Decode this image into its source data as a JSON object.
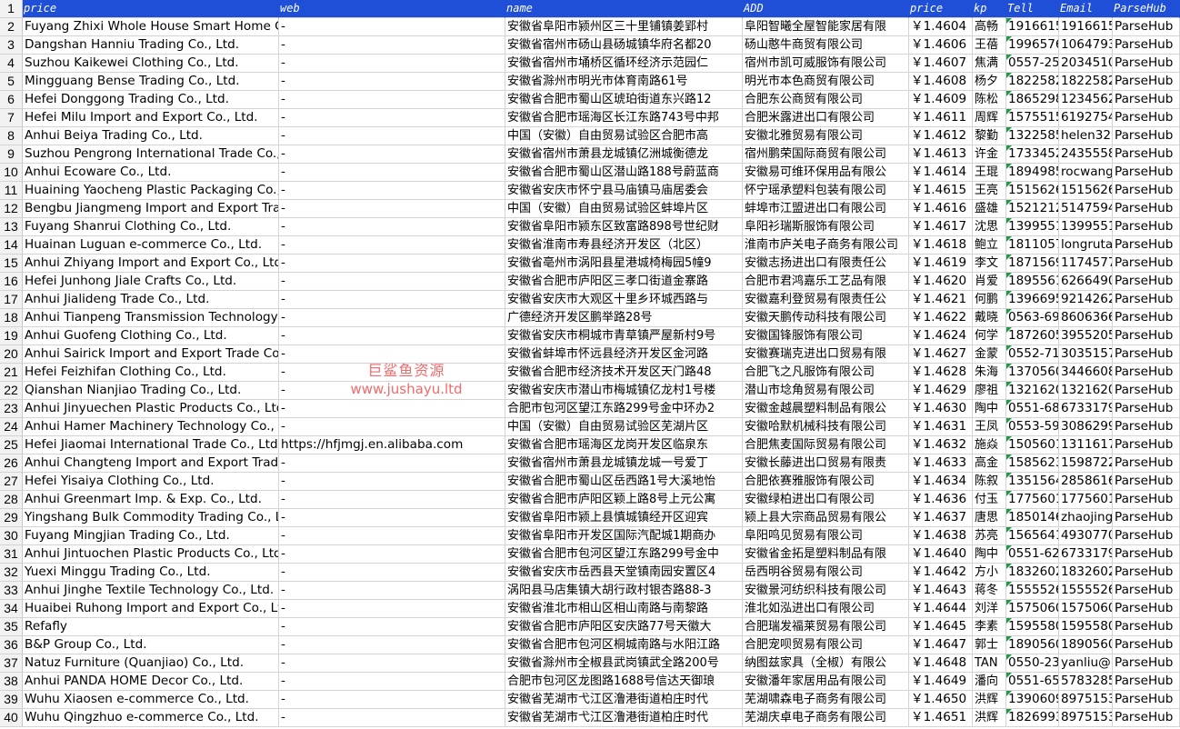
{
  "columns": [
    "price",
    "web",
    "name",
    "ADD",
    "price",
    "kp",
    "Tell",
    "Email",
    "ParseHub"
  ],
  "header_row_number": "1",
  "rows": [
    {
      "n": "2",
      "company": "Fuyang Zhixi Whole House Smart Home Co",
      "web": "-",
      "address": "安徽省阜阳市颍州区三十里铺镇姜郢村",
      "name_cn": "阜阳智曦全屋智能家居有限",
      "price": "￥1.4604",
      "kp": "高畅",
      "tell": "19166153",
      "email": "19166153",
      "src": "ParseHub"
    },
    {
      "n": "3",
      "company": "Dangshan Hanniu Trading Co., Ltd.",
      "web": "-",
      "address": "安徽省宿州市砀山县砀城镇华府名都20",
      "name_cn": "砀山憨牛商贸有限公司",
      "price": "￥1.4606",
      "kp": "王蓓",
      "tell": "19965766",
      "email": "10647930",
      "src": "ParseHub"
    },
    {
      "n": "4",
      "company": "Suzhou Kaikewei Clothing Co., Ltd.",
      "web": "-",
      "address": "安徽省宿州市埇桥区循环经济示范园仁",
      "name_cn": "宿州市凯可威服饰有限公司",
      "price": "￥1.4607",
      "kp": "焦满",
      "tell": "0557-25",
      "email": "20345104",
      "src": "ParseHub"
    },
    {
      "n": "5",
      "company": "Mingguang Bense Trading Co., Ltd.",
      "web": "-",
      "address": "安徽省滁州市明光市体育南路61号",
      "name_cn": "明光市本色商贸有限公司",
      "price": "￥1.4608",
      "kp": "杨夕",
      "tell": "18225821",
      "email": "18225821",
      "src": "ParseHub"
    },
    {
      "n": "6",
      "company": "Hefei Donggong Trading Co., Ltd.",
      "web": "-",
      "address": "安徽省合肥市蜀山区琥珀街道东兴路12",
      "name_cn": "合肥东公商贸有限公司",
      "price": "￥1.4609",
      "kp": "陈松",
      "tell": "18652981",
      "email": "12345620",
      "src": "ParseHub"
    },
    {
      "n": "7",
      "company": "Hefei Milu Import and Export Co., Ltd.",
      "web": "-",
      "address": "安徽省合肥市瑶海区长江东路743号中邦",
      "name_cn": "合肥米露进出口有限公司",
      "price": "￥1.4611",
      "kp": "周辉",
      "tell": "15755154",
      "email": "61927540",
      "src": "ParseHub"
    },
    {
      "n": "8",
      "company": "Anhui Beiya Trading Co., Ltd.",
      "web": "-",
      "address": "中国（安徽）自由贸易试验区合肥市高",
      "name_cn": "安徽北雅贸易有限公司",
      "price": "￥1.4612",
      "kp": "黎勤",
      "tell": "13225852",
      "email": "helen329",
      "src": "ParseHub"
    },
    {
      "n": "9",
      "company": "Suzhou Pengrong International Trade Co.,",
      "web": "-",
      "address": "安徽省宿州市萧县龙城镇亿洲城衡德龙",
      "name_cn": "宿州鹏荣国际商贸有限公司",
      "price": "￥1.4613",
      "kp": "许金",
      "tell": "17334522",
      "email": "24355583",
      "src": "ParseHub"
    },
    {
      "n": "10",
      "company": "Anhui Ecoware Co., Ltd.",
      "web": "-",
      "address": "安徽省合肥市蜀山区潜山路188号蔚蓝商",
      "name_cn": "安徽易可维环保用品有限公",
      "price": "￥1.4614",
      "kp": "王琨",
      "tell": "18949853",
      "email": "rocwang",
      "src": "ParseHub"
    },
    {
      "n": "11",
      "company": "Huaining Yaocheng Plastic Packaging Co., L",
      "web": "-",
      "address": "安徽省安庆市怀宁县马庙镇马庙居委会",
      "name_cn": "怀宁瑶承塑料包装有限公司",
      "price": "￥1.4615",
      "kp": "王亮",
      "tell": "15156268",
      "email": "15156268",
      "src": "ParseHub"
    },
    {
      "n": "12",
      "company": "Bengbu Jiangmeng Import and Export Trad",
      "web": "-",
      "address": "中国（安徽）自由贸易试验区蚌埠片区",
      "name_cn": "蚌埠市江盟进出口有限公司",
      "price": "￥1.4616",
      "kp": "盛雄",
      "tell": "15212126",
      "email": "51475945",
      "src": "ParseHub"
    },
    {
      "n": "13",
      "company": "Fuyang Shanrui Clothing Co., Ltd.",
      "web": "-",
      "address": "安徽省阜阳市颍东区致富路898号世纪财",
      "name_cn": "阜阳衫瑞斯服饰有限公司",
      "price": "￥1.4617",
      "kp": "沈思",
      "tell": "13995517",
      "email": "13995517",
      "src": "ParseHub"
    },
    {
      "n": "14",
      "company": "Huainan Luguan e-commerce Co., Ltd.",
      "web": "-",
      "address": "安徽省淮南市寿县经济开发区（北区）",
      "name_cn": "淮南市庐关电子商务有限公司",
      "price": "￥1.4618",
      "kp": "鲍立",
      "tell": "18110571",
      "email": "longruta",
      "src": "ParseHub"
    },
    {
      "n": "15",
      "company": "Anhui Zhiyang Import and Export Co., Ltd.",
      "web": "-",
      "address": "安徽省亳州市涡阳县星港城椅梅园5幢9",
      "name_cn": "安徽志扬进出口有限责任公",
      "price": "￥1.4619",
      "kp": "李文",
      "tell": "18715693",
      "email": "11745774",
      "src": "ParseHub"
    },
    {
      "n": "16",
      "company": "Hefei Junhong Jiale Crafts Co., Ltd.",
      "web": "-",
      "address": "安徽省合肥市庐阳区三孝口街道金寨路",
      "name_cn": "合肥市君鸿嘉乐工艺品有限",
      "price": "￥1.4620",
      "kp": "肖爱",
      "tell": "18955616",
      "email": "62664903",
      "src": "ParseHub"
    },
    {
      "n": "17",
      "company": "Anhui Jialideng Trade Co., Ltd.",
      "web": "-",
      "address": "安徽省安庆市大观区十里乡环城西路与",
      "name_cn": "安徽嘉利登贸易有限责任公",
      "price": "￥1.4621",
      "kp": "何鹏",
      "tell": "13966959",
      "email": "92142629",
      "src": "ParseHub"
    },
    {
      "n": "18",
      "company": "Anhui Tianpeng Transmission Technology C",
      "web": "-",
      "address": "广德经济开发区鹏举路28号",
      "name_cn": "安徽天鹏传动科技有限公司",
      "price": "￥1.4622",
      "kp": "戴晓",
      "tell": "0563-69",
      "email": "86063660",
      "src": "ParseHub"
    },
    {
      "n": "19",
      "company": "Anhui Guofeng Clothing Co., Ltd.",
      "web": "-",
      "address": "安徽省安庆市桐城市青草镇严屋新村9号",
      "name_cn": "安徽国锋服饰有限公司",
      "price": "￥1.4624",
      "kp": "何学",
      "tell": "18726059",
      "email": "39552058",
      "src": "ParseHub"
    },
    {
      "n": "20",
      "company": "Anhui Sairick Import and Export Trade Co.,",
      "web": "-",
      "address": "安徽省蚌埠市怀远县经济开发区金河路",
      "name_cn": "安徽赛瑞克进出口贸易有限",
      "price": "￥1.4627",
      "kp": "金蒙",
      "tell": "0552-71",
      "email": "30351571",
      "src": "ParseHub"
    },
    {
      "n": "21",
      "company": "Hefei Feizhifan Clothing Co., Ltd.",
      "web": "-",
      "address": "安徽省合肥市经济技术开发区天门路48",
      "name_cn": "合肥飞之凡服饰有限公司",
      "price": "￥1.4628",
      "kp": "朱海",
      "tell": "13705605",
      "email": "34466082",
      "src": "ParseHub"
    },
    {
      "n": "22",
      "company": "Qianshan Nianjiao Trading Co., Ltd.",
      "web": "-",
      "address": "安徽省安庆市潜山市梅城镇亿龙村1号楼",
      "name_cn": "潜山市埝角贸易有限公司",
      "price": "￥1.4629",
      "kp": "廖祖",
      "tell": "13216203",
      "email": "13216203",
      "src": "ParseHub"
    },
    {
      "n": "23",
      "company": "Anhui Jinyuechen Plastic Products Co., Ltd.",
      "web": "-",
      "address": "合肥市包河区望江东路299号金中环办2",
      "name_cn": "安徽金越晨塑料制品有限公",
      "price": "￥1.4630",
      "kp": "陶中",
      "tell": "0551-68",
      "email": "67331799",
      "src": "ParseHub"
    },
    {
      "n": "24",
      "company": "Anhui Hamer Machinery Technology Co., Lt",
      "web": "-",
      "address": "中国（安徽）自由贸易试验区芜湖片区",
      "name_cn": "安徽哈默机械科技有限公司",
      "price": "￥1.4631",
      "kp": "王凤",
      "tell": "0553-59",
      "email": "30862990",
      "src": "ParseHub"
    },
    {
      "n": "25",
      "company": "Hefei Jiaomai International Trade Co., Ltd.",
      "web": "https://hfjmgj.en.alibaba.com",
      "address": "安徽省合肥市瑶海区龙岗开发区临泉东",
      "name_cn": "合肥焦麦国际贸易有限公司",
      "price": "￥1.4632",
      "kp": "施焱",
      "tell": "15056016",
      "email": "13116179",
      "src": "ParseHub"
    },
    {
      "n": "26",
      "company": "Anhui Changteng Import and Export Trade",
      "web": "-",
      "address": "安徽省宿州市萧县龙城镇龙城一号爱丁",
      "name_cn": "安徽长藤进出口贸易有限责",
      "price": "￥1.4633",
      "kp": "高金",
      "tell": "15856236",
      "email": "15987221",
      "src": "ParseHub"
    },
    {
      "n": "27",
      "company": "Hefei Yisaiya Clothing Co., Ltd.",
      "web": "-",
      "address": "安徽省合肥市蜀山区岳西路1号大溪地怡",
      "name_cn": "合肥依赛雅服饰有限公司",
      "price": "￥1.4634",
      "kp": "陈叙",
      "tell": "13515643",
      "email": "28586166",
      "src": "ParseHub"
    },
    {
      "n": "28",
      "company": "Anhui Greenmart Imp. & Exp. Co., Ltd.",
      "web": "-",
      "address": "安徽省合肥市庐阳区颖上路8号上元公寓",
      "name_cn": "安徽绿柏进出口有限公司",
      "price": "￥1.4636",
      "kp": "付玉",
      "tell": "17756015",
      "email": "17756015",
      "src": "ParseHub"
    },
    {
      "n": "29",
      "company": "Yingshang Bulk Commodity Trading Co., Lt",
      "web": "-",
      "address": "安徽省阜阳市颍上县慎城镇经开区迎宾",
      "name_cn": "颍上县大宗商品贸易有限公",
      "price": "￥1.4637",
      "kp": "唐思",
      "tell": "18501464",
      "email": "zhaojing",
      "src": "ParseHub"
    },
    {
      "n": "30",
      "company": "Fuyang Mingjian Trading Co., Ltd.",
      "web": "-",
      "address": "安徽省阜阳市开发区国际汽配城1期商办",
      "name_cn": "阜阳鸣见贸易有限公司",
      "price": "￥1.4638",
      "kp": "苏亮",
      "tell": "15656418",
      "email": "49307708",
      "src": "ParseHub"
    },
    {
      "n": "31",
      "company": "Anhui Jintuochen Plastic Products Co., Ltd.",
      "web": "-",
      "address": "安徽省合肥市包河区望江东路299号金中",
      "name_cn": "安徽省金拓是塑料制品有限",
      "price": "￥1.4640",
      "kp": "陶中",
      "tell": "0551-62",
      "email": "67331799",
      "src": "ParseHub"
    },
    {
      "n": "32",
      "company": "Yuexi Minggu Trading Co., Ltd.",
      "web": "-",
      "address": "安徽省安庆市岳西县天堂镇南园安置区4",
      "name_cn": "岳西明谷贸易有限公司",
      "price": "￥1.4642",
      "kp": "方小",
      "tell": "18326028",
      "email": "18326028",
      "src": "ParseHub"
    },
    {
      "n": "33",
      "company": "Anhui Jinghe Textile Technology Co., Ltd.",
      "web": "-",
      "address": "涡阳县马店集镇大胡行政村银杏路88-3",
      "name_cn": "安徽景河纺织科技有限公司",
      "price": "￥1.4643",
      "kp": "蒋冬",
      "tell": "15555268",
      "email": "15555268",
      "src": "ParseHub"
    },
    {
      "n": "34",
      "company": "Huaibei Ruhong Import and Export Co., Ltd",
      "web": "-",
      "address": "安徽省淮北市相山区相山南路与南黎路",
      "name_cn": "淮北如泓进出口有限公司",
      "price": "￥1.4644",
      "kp": "刘洋",
      "tell": "15750609",
      "email": "15750609",
      "src": "ParseHub"
    },
    {
      "n": "35",
      "company": "Refafly",
      "web": "-",
      "address": "安徽省合肥市庐阳区安庆路77号天徽大",
      "name_cn": "合肥瑞发福莱贸易有限公司",
      "price": "￥1.4645",
      "kp": "李素",
      "tell": "15955806",
      "email": "15955806",
      "src": "ParseHub"
    },
    {
      "n": "36",
      "company": "B&P Group Co., Ltd.",
      "web": "-",
      "address": "安徽省合肥市包河区桐城南路与水阳江路",
      "name_cn": "合肥宠呗贸易有限公司",
      "price": "￥1.4647",
      "kp": "郭士",
      "tell": "18905601",
      "email": "18905601",
      "src": "ParseHub"
    },
    {
      "n": "37",
      "company": "Natuz Furniture (Quanjiao) Co., Ltd.",
      "web": "-",
      "address": "安徽省滁州市全椒县武岗镇武全路200号",
      "name_cn": "纳图兹家具（全椒）有限公",
      "price": "￥1.4648",
      "kp": "TAN",
      "tell": "0550-23",
      "email": "yanliu@n",
      "src": "ParseHub"
    },
    {
      "n": "38",
      "company": "Anhui PANDA HOME Decor Co., Ltd.",
      "web": "-",
      "address": "合肥市包河区龙图路1688号信达天御琅",
      "name_cn": "安徽潘年家居用品有限公司",
      "price": "￥1.4649",
      "kp": "潘向",
      "tell": "0551-65",
      "email": "57832858",
      "src": "ParseHub"
    },
    {
      "n": "39",
      "company": "Wuhu Xiaosen e-commerce Co., Ltd.",
      "web": "-",
      "address": "安徽省芜湖市弋江区澛港街道柏庄时代",
      "name_cn": "芜湖啸森电子商务有限公司",
      "price": "￥1.4650",
      "kp": "洪辉",
      "tell": "13906098",
      "email": "89751539",
      "src": "ParseHub"
    },
    {
      "n": "40",
      "company": "Wuhu Qingzhuo e-commerce Co., Ltd.",
      "web": "-",
      "address": "安徽省芜湖市弋江区澛港街道柏庄时代",
      "name_cn": "芜湖庆卓电子商务有限公司",
      "price": "￥1.4651",
      "kp": "洪辉",
      "tell": "18269938",
      "email": "89751539",
      "src": "ParseHub"
    }
  ],
  "watermark": {
    "line1": "巨鲨鱼资源",
    "line2": "www.jushayu.ltd"
  },
  "colors": {
    "header_bg": "#1e4fd6",
    "header_text": "#ffffff",
    "watermark": "#f26a6a",
    "comment_flag": "#1f9a46"
  }
}
